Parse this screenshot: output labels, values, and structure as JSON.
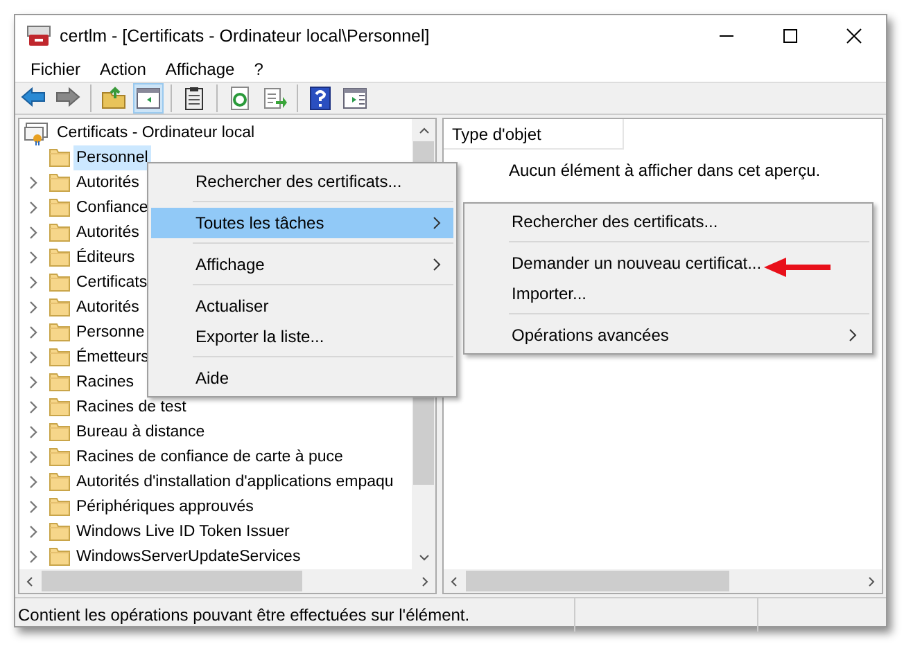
{
  "window": {
    "title": "certlm - [Certificats - Ordinateur local\\Personnel]"
  },
  "menu_bar": [
    "Fichier",
    "Action",
    "Affichage",
    "?"
  ],
  "toolbar": [
    [
      {
        "kind": "back",
        "pressed": false
      },
      {
        "kind": "forward",
        "pressed": false
      }
    ],
    [
      {
        "kind": "up",
        "pressed": false
      },
      {
        "kind": "tree",
        "pressed": true
      }
    ],
    [
      {
        "kind": "clipboard",
        "pressed": false
      }
    ],
    [
      {
        "kind": "refresh",
        "pressed": false
      },
      {
        "kind": "export",
        "pressed": false
      }
    ],
    [
      {
        "kind": "help",
        "pressed": false
      },
      {
        "kind": "panel",
        "pressed": false
      }
    ]
  ],
  "tree": {
    "label": "Certificats - Ordinateur local",
    "children": [
      {
        "label": "Personnel",
        "expandable": false,
        "selected": true
      },
      {
        "label": "Autorités",
        "expandable": true,
        "selected": false
      },
      {
        "label": "Confiance",
        "expandable": true,
        "selected": false
      },
      {
        "label": "Autorités",
        "expandable": true,
        "selected": false
      },
      {
        "label": "Éditeurs",
        "expandable": true,
        "selected": false
      },
      {
        "label": "Certificats",
        "expandable": true,
        "selected": false
      },
      {
        "label": "Autorités",
        "expandable": true,
        "selected": false
      },
      {
        "label": "Personne",
        "expandable": true,
        "selected": false
      },
      {
        "label": "Émetteurs",
        "expandable": true,
        "selected": false
      },
      {
        "label": "Racines",
        "expandable": true,
        "selected": false
      },
      {
        "label": "Racines de test",
        "expandable": true,
        "selected": false
      },
      {
        "label": "Bureau à distance",
        "expandable": true,
        "selected": false
      },
      {
        "label": "Racines de confiance de carte à puce",
        "expandable": true,
        "selected": false
      },
      {
        "label": "Autorités d'installation d'applications empaqu",
        "expandable": true,
        "selected": false
      },
      {
        "label": "Périphériques approuvés",
        "expandable": true,
        "selected": false
      },
      {
        "label": "Windows Live ID Token Issuer",
        "expandable": true,
        "selected": false
      },
      {
        "label": "WindowsServerUpdateServices",
        "expandable": true,
        "selected": false
      }
    ]
  },
  "details": {
    "column": "Type d'objet",
    "empty_message": "Aucun élément à afficher dans cet aperçu."
  },
  "context_menu": [
    {
      "kind": "item",
      "label": "Rechercher des certificats...",
      "submenu": false,
      "selected": false
    },
    {
      "kind": "separator"
    },
    {
      "kind": "item",
      "label": "Toutes les tâches",
      "submenu": true,
      "selected": true
    },
    {
      "kind": "separator"
    },
    {
      "kind": "item",
      "label": "Affichage",
      "submenu": true,
      "selected": false
    },
    {
      "kind": "separator"
    },
    {
      "kind": "item",
      "label": "Actualiser",
      "submenu": false,
      "selected": false
    },
    {
      "kind": "item",
      "label": "Exporter la liste...",
      "submenu": false,
      "selected": false
    },
    {
      "kind": "separator"
    },
    {
      "kind": "item",
      "label": "Aide",
      "submenu": false,
      "selected": false
    }
  ],
  "submenu": [
    {
      "kind": "item",
      "label": "Rechercher des certificats...",
      "submenu": false,
      "selected": false
    },
    {
      "kind": "separator"
    },
    {
      "kind": "item",
      "label": "Demander un nouveau certificat...",
      "submenu": false,
      "selected": false
    },
    {
      "kind": "item",
      "label": "Importer...",
      "submenu": false,
      "selected": false
    },
    {
      "kind": "separator"
    },
    {
      "kind": "item",
      "label": "Opérations avancées",
      "submenu": true,
      "selected": false
    }
  ],
  "status_bar": "Contient les opérations pouvant être effectuées sur l'élément."
}
